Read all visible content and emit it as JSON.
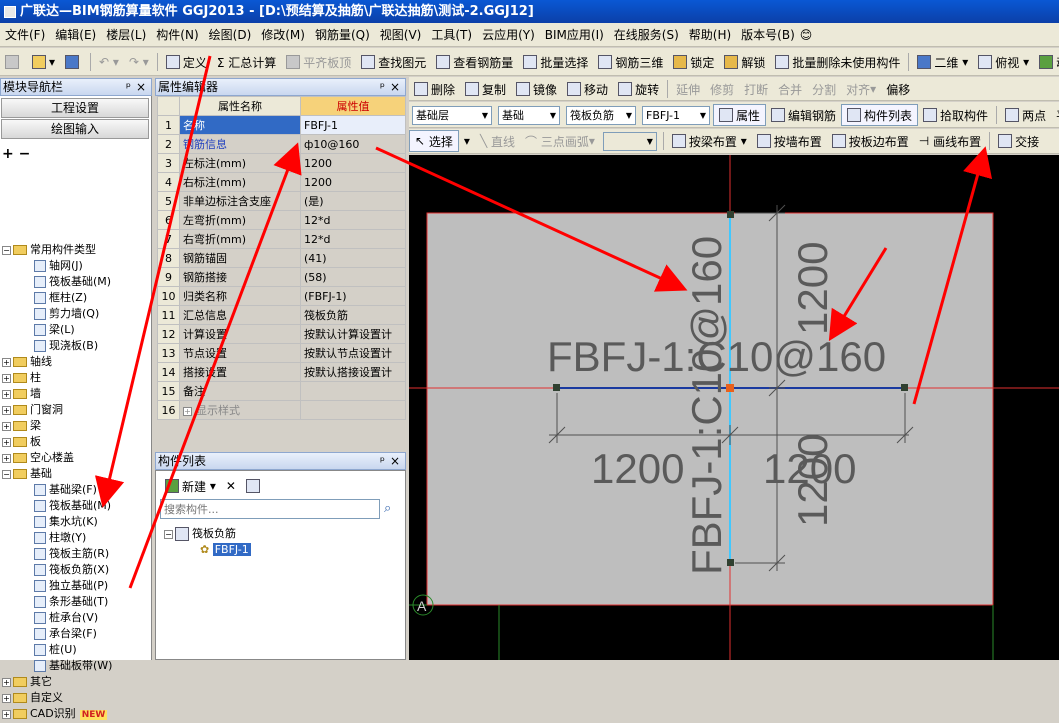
{
  "titlebar": {
    "text": "广联达—BIM钢筋算量软件 GGJ2013 - [D:\\预结算及抽筋\\广联达抽筋\\测试-2.GGJ12]"
  },
  "menu": [
    "文件(F)",
    "编辑(E)",
    "楼层(L)",
    "构件(N)",
    "绘图(D)",
    "修改(M)",
    "钢筋量(Q)",
    "视图(V)",
    "工具(T)",
    "云应用(Y)",
    "BIM应用(I)",
    "在线服务(S)",
    "帮助(H)",
    "版本号(B)"
  ],
  "toolbar1": {
    "define": "定义",
    "sum": "Σ 汇总计算",
    "flat_top": "平齐板顶",
    "find_element": "查找图元",
    "view_rebar": "查看钢筋量",
    "batch_select": "批量选择",
    "rebar_3d": "钢筋三维",
    "lock": "锁定",
    "unlock": "解锁",
    "batch_delete": "批量删除未使用构件",
    "view_2d": "二维",
    "view_mode": "俯视",
    "dynamic": "动"
  },
  "toolbar2": {
    "delete": "删除",
    "copy": "复制",
    "mirror": "镜像",
    "move": "移动",
    "rotate": "旋转",
    "extend": "延伸",
    "trim": "修剪",
    "break": "打断",
    "merge": "合并",
    "split": "分割",
    "align": "对齐",
    "offset": "偏移"
  },
  "toolbar3": {
    "layer": "基础层",
    "category": "基础",
    "type": "筏板负筋",
    "element": "FBFJ-1",
    "properties": "属性",
    "edit_rebar": "编辑钢筋",
    "component_list": "构件列表",
    "pick": "拾取构件",
    "two_points": "两点",
    "parallel": "平"
  },
  "toolbar4": {
    "select": "选择",
    "line": "直线",
    "arc": "三点画弧",
    "by_beam": "按梁布置",
    "by_wall": "按墙布置",
    "by_slab_edge": "按板边布置",
    "draw_line": "画线布置",
    "cross": "交接"
  },
  "nav": {
    "title": "模块导航栏",
    "pin": "📌",
    "close": "×",
    "project_settings": "工程设置",
    "drawing_input": "绘图输入",
    "tree": [
      {
        "label": "常用构件类型",
        "level": 0,
        "kind": "folder",
        "expanded": true
      },
      {
        "label": "轴网(J)",
        "level": 1,
        "kind": "item"
      },
      {
        "label": "筏板基础(M)",
        "level": 1,
        "kind": "item"
      },
      {
        "label": "框柱(Z)",
        "level": 1,
        "kind": "item"
      },
      {
        "label": "剪力墙(Q)",
        "level": 1,
        "kind": "item"
      },
      {
        "label": "梁(L)",
        "level": 1,
        "kind": "item"
      },
      {
        "label": "现浇板(B)",
        "level": 1,
        "kind": "item"
      },
      {
        "label": "轴线",
        "level": 0,
        "kind": "folder"
      },
      {
        "label": "柱",
        "level": 0,
        "kind": "folder"
      },
      {
        "label": "墙",
        "level": 0,
        "kind": "folder"
      },
      {
        "label": "门窗洞",
        "level": 0,
        "kind": "folder"
      },
      {
        "label": "梁",
        "level": 0,
        "kind": "folder"
      },
      {
        "label": "板",
        "level": 0,
        "kind": "folder"
      },
      {
        "label": "空心楼盖",
        "level": 0,
        "kind": "folder"
      },
      {
        "label": "基础",
        "level": 0,
        "kind": "folder",
        "expanded": true
      },
      {
        "label": "基础梁(F)",
        "level": 1,
        "kind": "item"
      },
      {
        "label": "筏板基础(M)",
        "level": 1,
        "kind": "item"
      },
      {
        "label": "集水坑(K)",
        "level": 1,
        "kind": "item"
      },
      {
        "label": "柱墩(Y)",
        "level": 1,
        "kind": "item"
      },
      {
        "label": "筏板主筋(R)",
        "level": 1,
        "kind": "item"
      },
      {
        "label": "筏板负筋(X)",
        "level": 1,
        "kind": "item"
      },
      {
        "label": "独立基础(P)",
        "level": 1,
        "kind": "item"
      },
      {
        "label": "条形基础(T)",
        "level": 1,
        "kind": "item"
      },
      {
        "label": "桩承台(V)",
        "level": 1,
        "kind": "item"
      },
      {
        "label": "承台梁(F)",
        "level": 1,
        "kind": "item"
      },
      {
        "label": "桩(U)",
        "level": 1,
        "kind": "item"
      },
      {
        "label": "基础板带(W)",
        "level": 1,
        "kind": "item"
      },
      {
        "label": "其它",
        "level": 0,
        "kind": "folder"
      },
      {
        "label": "自定义",
        "level": 0,
        "kind": "folder"
      },
      {
        "label": "CAD识别",
        "level": 0,
        "kind": "folder",
        "badge": "NEW"
      }
    ]
  },
  "props": {
    "title": "属性编辑器",
    "col_name": "属性名称",
    "col_value": "属性值",
    "rows": [
      {
        "num": "1",
        "name": "名称",
        "value": "FBFJ-1"
      },
      {
        "num": "2",
        "name": "钢筋信息",
        "value": "ф10@160"
      },
      {
        "num": "3",
        "name": "左标注(mm)",
        "value": "1200"
      },
      {
        "num": "4",
        "name": "右标注(mm)",
        "value": "1200"
      },
      {
        "num": "5",
        "name": "非单边标注含支座",
        "value": "(是)"
      },
      {
        "num": "6",
        "name": "左弯折(mm)",
        "value": "12*d"
      },
      {
        "num": "7",
        "name": "右弯折(mm)",
        "value": "12*d"
      },
      {
        "num": "8",
        "name": "钢筋锚固",
        "value": "(41)"
      },
      {
        "num": "9",
        "name": "钢筋搭接",
        "value": "(58)"
      },
      {
        "num": "10",
        "name": "归类名称",
        "value": "(FBFJ-1)"
      },
      {
        "num": "11",
        "name": "汇总信息",
        "value": "筏板负筋"
      },
      {
        "num": "12",
        "name": "计算设置",
        "value": "按默认计算设置计"
      },
      {
        "num": "13",
        "name": "节点设置",
        "value": "按默认节点设置计"
      },
      {
        "num": "14",
        "name": "搭接设置",
        "value": "按默认搭接设置计"
      },
      {
        "num": "15",
        "name": "备注",
        "value": ""
      },
      {
        "num": "16",
        "name": "显示样式",
        "value": ""
      }
    ]
  },
  "complist": {
    "title": "构件列表",
    "new": "新建",
    "search_placeholder": "搜索构件...",
    "group": "筏板负筋",
    "item": "FBFJ-1"
  },
  "canvas_labels": {
    "horizontal": "FBFJ-1:C10@160",
    "vertical": "FBFJ-1:C10@160",
    "dim_left": "1200",
    "dim_right": "1200",
    "dim_top": "1200",
    "dim_bottom": "1200",
    "axis_a": "A"
  }
}
